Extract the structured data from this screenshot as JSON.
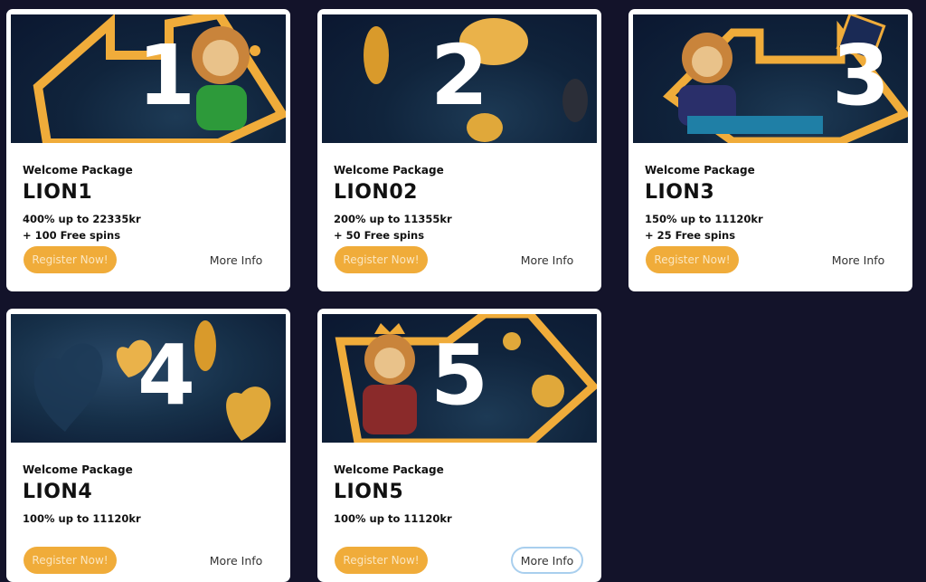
{
  "colors": {
    "page_background": "#13132a",
    "card_background": "#ffffff",
    "accent_gold": "#f0ac3a",
    "banner_navy": "#10243c"
  },
  "offers": [
    {
      "number": "1",
      "package_label": "Welcome Package",
      "code": "LION1",
      "line1": "400% up to 22335kr",
      "line2": "+ 100 Free spins",
      "register_label": "Register Now!",
      "info_label": "More Info"
    },
    {
      "number": "2",
      "package_label": "Welcome Package",
      "code": "LION02",
      "line1": "200% up to 11355kr",
      "line2": "+ 50 Free spins",
      "register_label": "Register Now!",
      "info_label": "More Info"
    },
    {
      "number": "3",
      "package_label": "Welcome Package",
      "code": "LION3",
      "line1": "150% up to 11120kr",
      "line2": "+ 25 Free spins",
      "register_label": "Register Now!",
      "info_label": "More Info"
    },
    {
      "number": "4",
      "package_label": "Welcome Package",
      "code": "LION4",
      "line1": "100% up to 11120kr",
      "register_label": "Register Now!",
      "info_label": "More Info"
    },
    {
      "number": "5",
      "package_label": "Welcome Package",
      "code": "LION5",
      "line1": "100% up to 11120kr",
      "register_label": "Register Now!",
      "info_label": "More Info"
    }
  ]
}
